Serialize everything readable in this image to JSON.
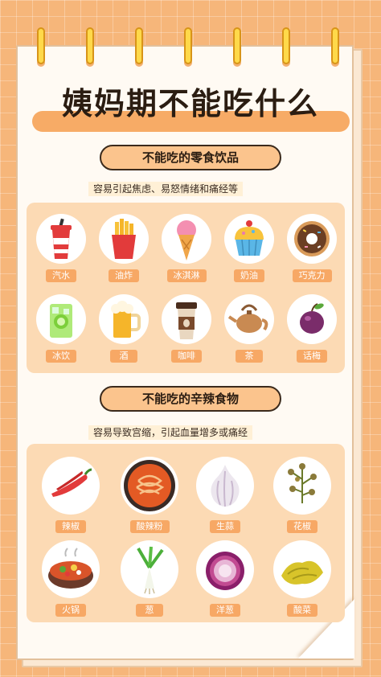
{
  "title": "姨妈期不能吃什么",
  "section1": {
    "heading": "不能吃的零食饮品",
    "note": "容易引起焦虑、易怒情绪和痛经等",
    "items": [
      {
        "label": "汽水",
        "icon": "soda-icon"
      },
      {
        "label": "油炸",
        "icon": "fries-icon"
      },
      {
        "label": "冰淇淋",
        "icon": "ice-cream-icon"
      },
      {
        "label": "奶油",
        "icon": "cupcake-icon"
      },
      {
        "label": "巧克力",
        "icon": "chocolate-donut-icon"
      },
      {
        "label": "冰饮",
        "icon": "iced-drink-icon"
      },
      {
        "label": "酒",
        "icon": "beer-icon"
      },
      {
        "label": "咖啡",
        "icon": "coffee-icon"
      },
      {
        "label": "茶",
        "icon": "teapot-icon"
      },
      {
        "label": "话梅",
        "icon": "plum-icon"
      }
    ]
  },
  "section2": {
    "heading": "不能吃的辛辣食物",
    "note": "容易导致宫缩，引起血量增多或痛经",
    "items": [
      {
        "label": "辣椒",
        "icon": "chili-icon"
      },
      {
        "label": "酸辣粉",
        "icon": "noodle-bowl-icon"
      },
      {
        "label": "生蒜",
        "icon": "garlic-icon"
      },
      {
        "label": "花椒",
        "icon": "peppercorn-icon"
      },
      {
        "label": "火锅",
        "icon": "hotpot-icon"
      },
      {
        "label": "葱",
        "icon": "scallion-icon"
      },
      {
        "label": "洋葱",
        "icon": "onion-icon"
      },
      {
        "label": "酸菜",
        "icon": "pickled-cabbage-icon"
      }
    ]
  },
  "colors": {
    "background": "#f6b67a",
    "accent": "#f7a865",
    "panel": "#fcdab4",
    "ring": "#ffd94a"
  }
}
